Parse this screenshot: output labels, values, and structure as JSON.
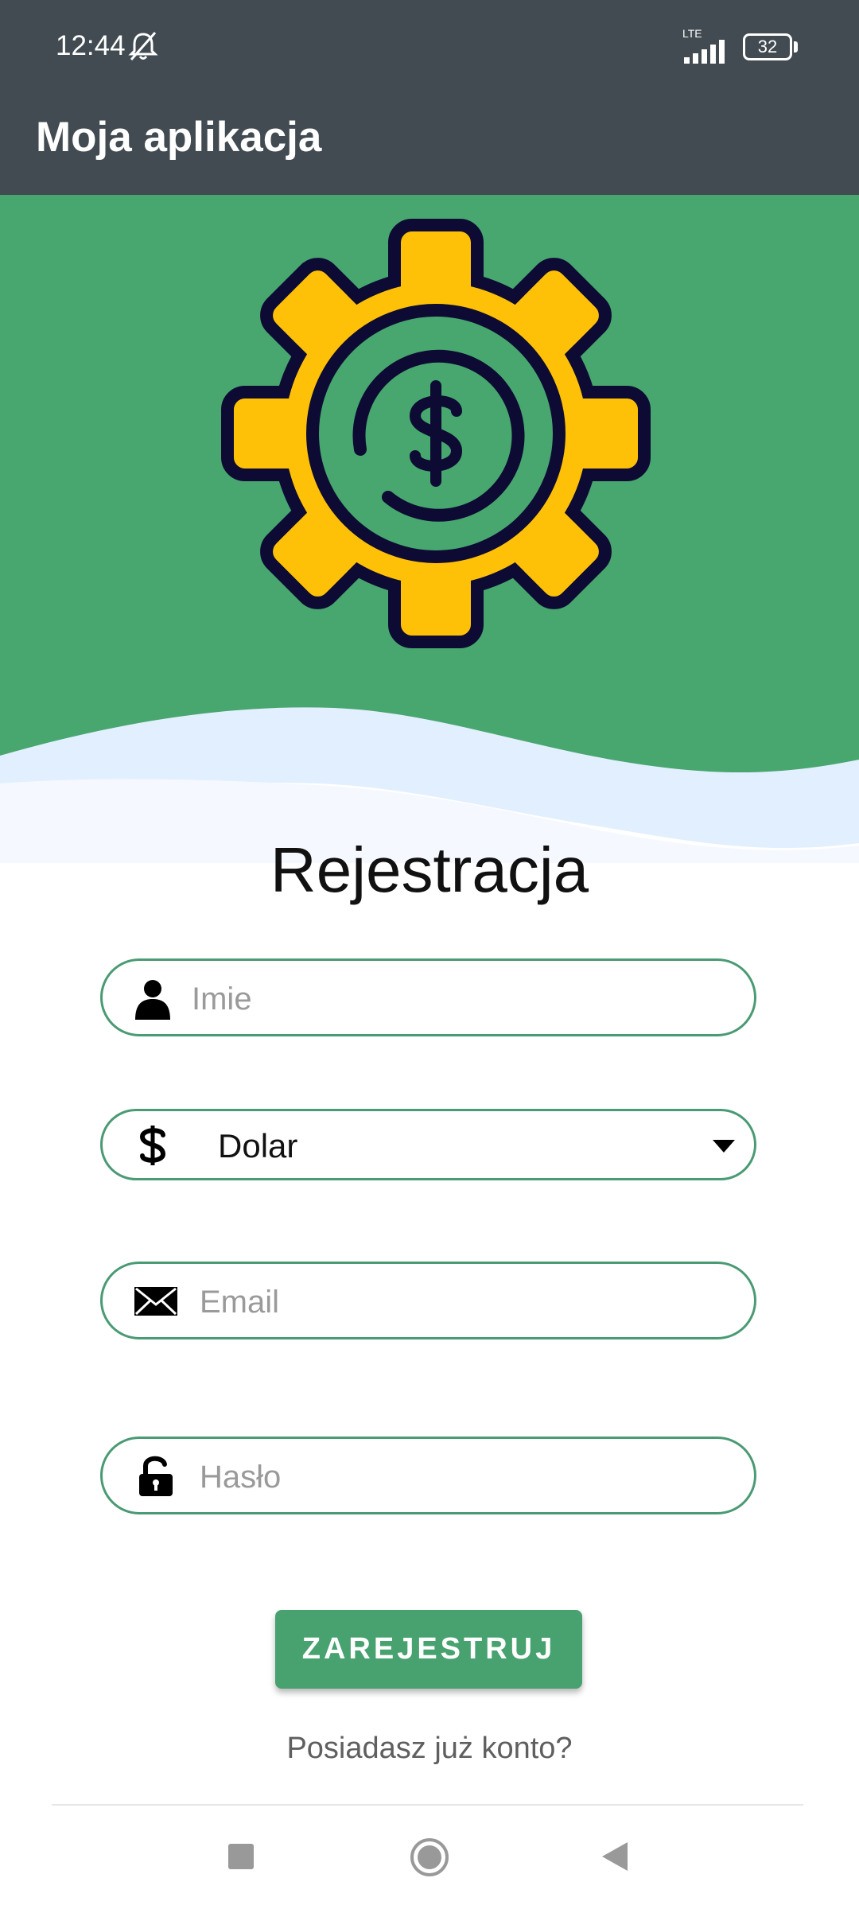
{
  "status_bar": {
    "time": "12:44",
    "network": "LTE",
    "battery": "32",
    "icons": [
      "bell-off-icon",
      "signal-icon",
      "battery-icon"
    ]
  },
  "app_bar": {
    "title": "Moja aplikacja"
  },
  "hero": {
    "icon": "gear-dollar-icon"
  },
  "form": {
    "heading": "Rejestracja",
    "name_placeholder": "Imie",
    "currency_value": "Dolar",
    "email_placeholder": "Email",
    "password_placeholder": "Hasło",
    "submit_label": "ZAREJESTRUJ",
    "login_link": "Posiadasz już konto?"
  },
  "nav_bar": {
    "icons": [
      "recents-square-icon",
      "home-circle-icon",
      "back-triangle-icon"
    ]
  },
  "colors": {
    "app_bar": "#414b51",
    "hero_green": "#48a66f",
    "accent": "#4a9a74",
    "gear_yellow": "#ffc107",
    "gear_outline": "#0d0b33"
  }
}
